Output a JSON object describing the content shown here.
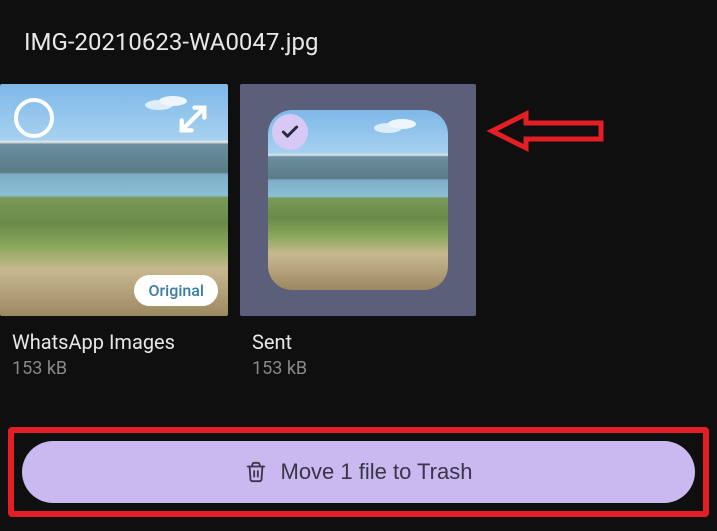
{
  "header": {
    "title": "IMG-20210623-WA0047.jpg"
  },
  "thumbnails": [
    {
      "label": "WhatsApp Images",
      "size": "153 kB",
      "badge": "Original",
      "selected": false
    },
    {
      "label": "Sent",
      "size": "153 kB",
      "selected": true
    }
  ],
  "action": {
    "button_label": "Move 1 file to Trash"
  },
  "annotations": {
    "arrow_target": "thumbnail-sent",
    "highlight_target": "move-to-trash-button"
  },
  "colors": {
    "background": "#0f0f0f",
    "accent": "#c9b9f0",
    "annotation": "#e31e24"
  }
}
